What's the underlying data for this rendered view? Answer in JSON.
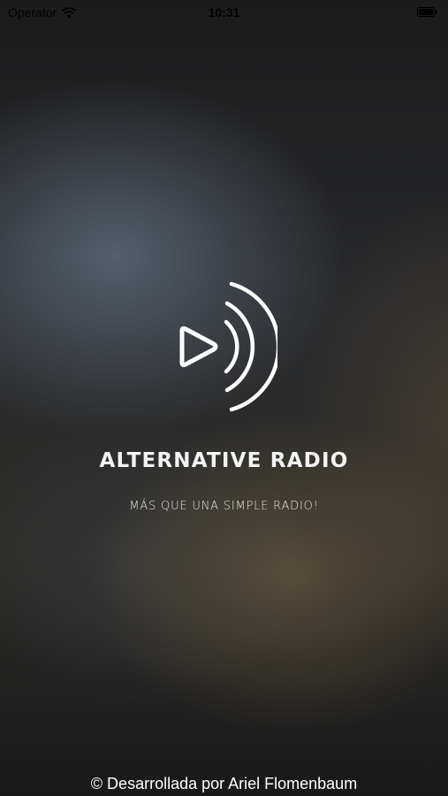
{
  "status_bar": {
    "carrier": "Operator",
    "time": "10:31",
    "wifi_icon": "wifi-icon",
    "battery_icon": "battery-icon"
  },
  "splash": {
    "logo_icon": "play-signal-icon",
    "title": "ALTERNATIVE RADIO",
    "tagline": "MÁS QUE UNA SIMPLE RADIO!",
    "credit": "© Desarrollada por Ariel Flomenbaum"
  },
  "colors": {
    "text": "#ffffff",
    "status_text": "#000000",
    "background": "#1a1a1b"
  }
}
